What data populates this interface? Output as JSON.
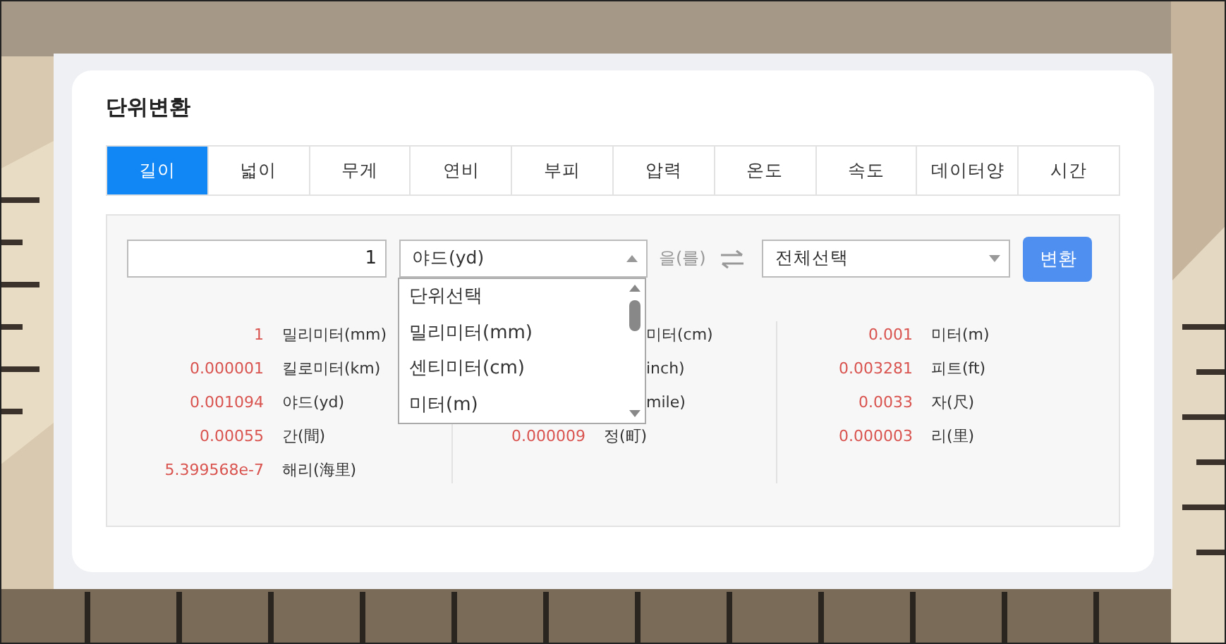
{
  "title": "단위변환",
  "tabs": [
    {
      "label": "길이",
      "selected": true
    },
    {
      "label": "넓이",
      "selected": false
    },
    {
      "label": "무게",
      "selected": false
    },
    {
      "label": "연비",
      "selected": false
    },
    {
      "label": "부피",
      "selected": false
    },
    {
      "label": "압력",
      "selected": false
    },
    {
      "label": "온도",
      "selected": false
    },
    {
      "label": "속도",
      "selected": false
    },
    {
      "label": "데이터양",
      "selected": false
    },
    {
      "label": "시간",
      "selected": false
    }
  ],
  "amount_field": {
    "value": "1"
  },
  "from_unit": {
    "value": "야드(yd)",
    "expanded": true,
    "options": [
      {
        "label": "단위선택",
        "selected": false
      },
      {
        "label": "밀리미터(mm)",
        "selected": false
      },
      {
        "label": "센티미터(cm)",
        "selected": false
      },
      {
        "label": "미터(m)",
        "selected": false
      }
    ]
  },
  "particle": "을(를)",
  "to_unit": {
    "value": "전체선택"
  },
  "convert_button": "변환",
  "results": [
    [
      {
        "value": "1",
        "unit": "밀리미터(mm)"
      },
      {
        "value": "0.000001",
        "unit": "킬로미터(km)"
      },
      {
        "value": "0.001094",
        "unit": "야드(yd)"
      },
      {
        "value": "0.00055",
        "unit": "간(間)"
      },
      {
        "value": "5.399568e-7",
        "unit": "해리(海里)"
      }
    ],
    [
      {
        "unit": "미터(cm)"
      },
      {
        "unit": "inch)"
      },
      {
        "unit": "mile)"
      },
      {
        "value": "0.000009",
        "unit": "정(町)"
      }
    ],
    [
      {
        "value": "0.001",
        "unit": "미터(m)"
      },
      {
        "value": "0.003281",
        "unit": "피트(ft)"
      },
      {
        "value": "0.0033",
        "unit": "자(尺)"
      },
      {
        "value": "0.000003",
        "unit": "리(里)"
      }
    ]
  ]
}
